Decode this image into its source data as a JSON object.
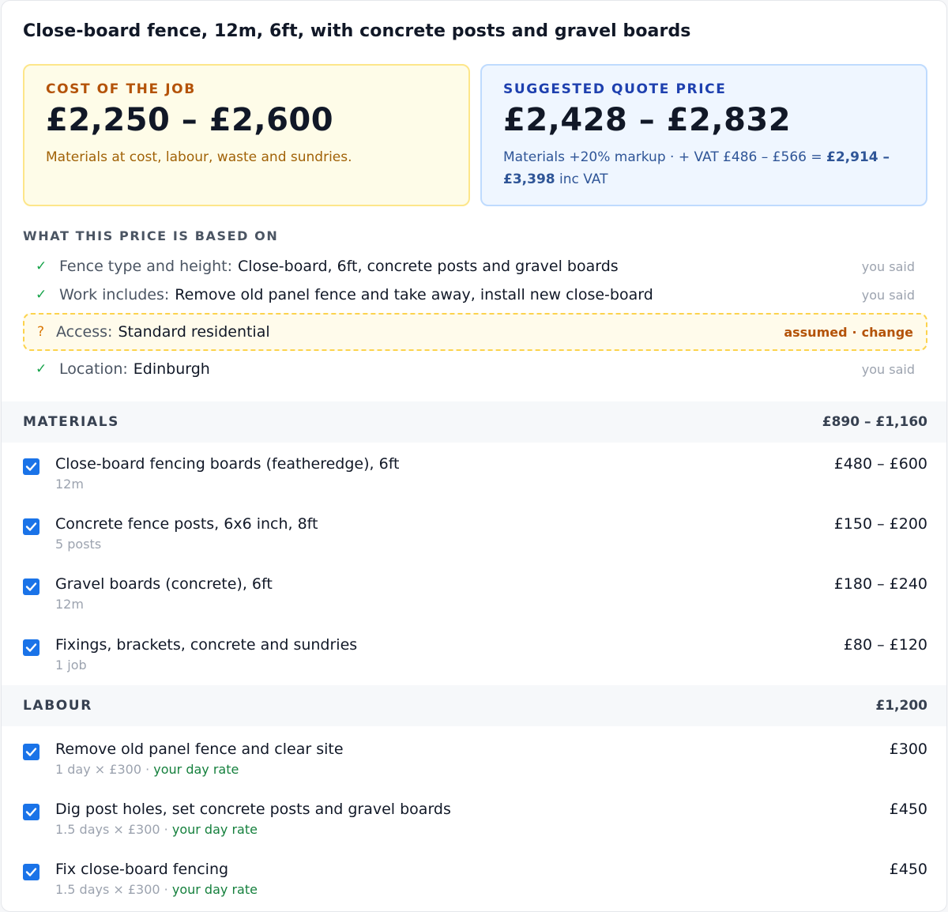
{
  "title": "Close-board fence, 12m, 6ft, with concrete posts and gravel boards",
  "cost": {
    "label": "COST OF THE JOB",
    "value": "£2,250 – £2,600",
    "note": "Materials at cost, labour, waste and sundries."
  },
  "quote": {
    "label": "SUGGESTED QUOTE PRICE",
    "value": "£2,428 – £2,832",
    "note_prefix": "Materials +20% markup · + VAT £486 – £566 = ",
    "inc_vat": "£2,914 – £3,398",
    "note_suffix": " inc VAT"
  },
  "basis": {
    "heading": "WHAT THIS PRICE IS BASED ON",
    "items": [
      {
        "label": "Fence type and height:",
        "value": "Close-board, 6ft, concrete posts and gravel boards",
        "tag": "you said",
        "mark": "✓"
      },
      {
        "label": "Work includes:",
        "value": "Remove old panel fence and take away, install new close-board",
        "tag": "you said",
        "mark": "✓"
      },
      {
        "label": "Access:",
        "value": "Standard residential",
        "tag": "assumed",
        "change": "change",
        "mark": "?"
      },
      {
        "label": "Location:",
        "value": "Edinburgh",
        "tag": "you said",
        "mark": "✓"
      }
    ]
  },
  "materials": {
    "heading": "MATERIALS",
    "total": "£890 – £1,160",
    "items": [
      {
        "name": "Close-board fencing boards (featheredge), 6ft",
        "qty": "12m",
        "price": "£480 – £600",
        "checked": true
      },
      {
        "name": "Concrete fence posts, 6x6 inch, 8ft",
        "qty": "5 posts",
        "price": "£150 – £200",
        "checked": true
      },
      {
        "name": "Gravel boards (concrete), 6ft",
        "qty": "12m",
        "price": "£180 – £240",
        "checked": true
      },
      {
        "name": "Fixings, brackets, concrete and sundries",
        "qty": "1 job",
        "price": "£80 – £120",
        "checked": true
      }
    ]
  },
  "labour": {
    "heading": "LABOUR",
    "total": "£1,200",
    "items": [
      {
        "name": "Remove old panel fence and clear site",
        "qty": "1 day × £300 · ",
        "rate": "your day rate",
        "price": "£300",
        "checked": true
      },
      {
        "name": "Dig post holes, set concrete posts and gravel boards",
        "qty": "1.5 days × £300 · ",
        "rate": "your day rate",
        "price": "£450",
        "checked": true
      },
      {
        "name": "Fix close-board fencing",
        "qty": "1.5 days × £300 · ",
        "rate": "your day rate",
        "price": "£450",
        "checked": true
      }
    ]
  },
  "colors": {
    "checkbox": "#1a73e8",
    "cost_bg": "#fefce8",
    "quote_bg": "#eff6ff",
    "check_green": "#16a34a",
    "assumed_amber": "#b45309"
  }
}
